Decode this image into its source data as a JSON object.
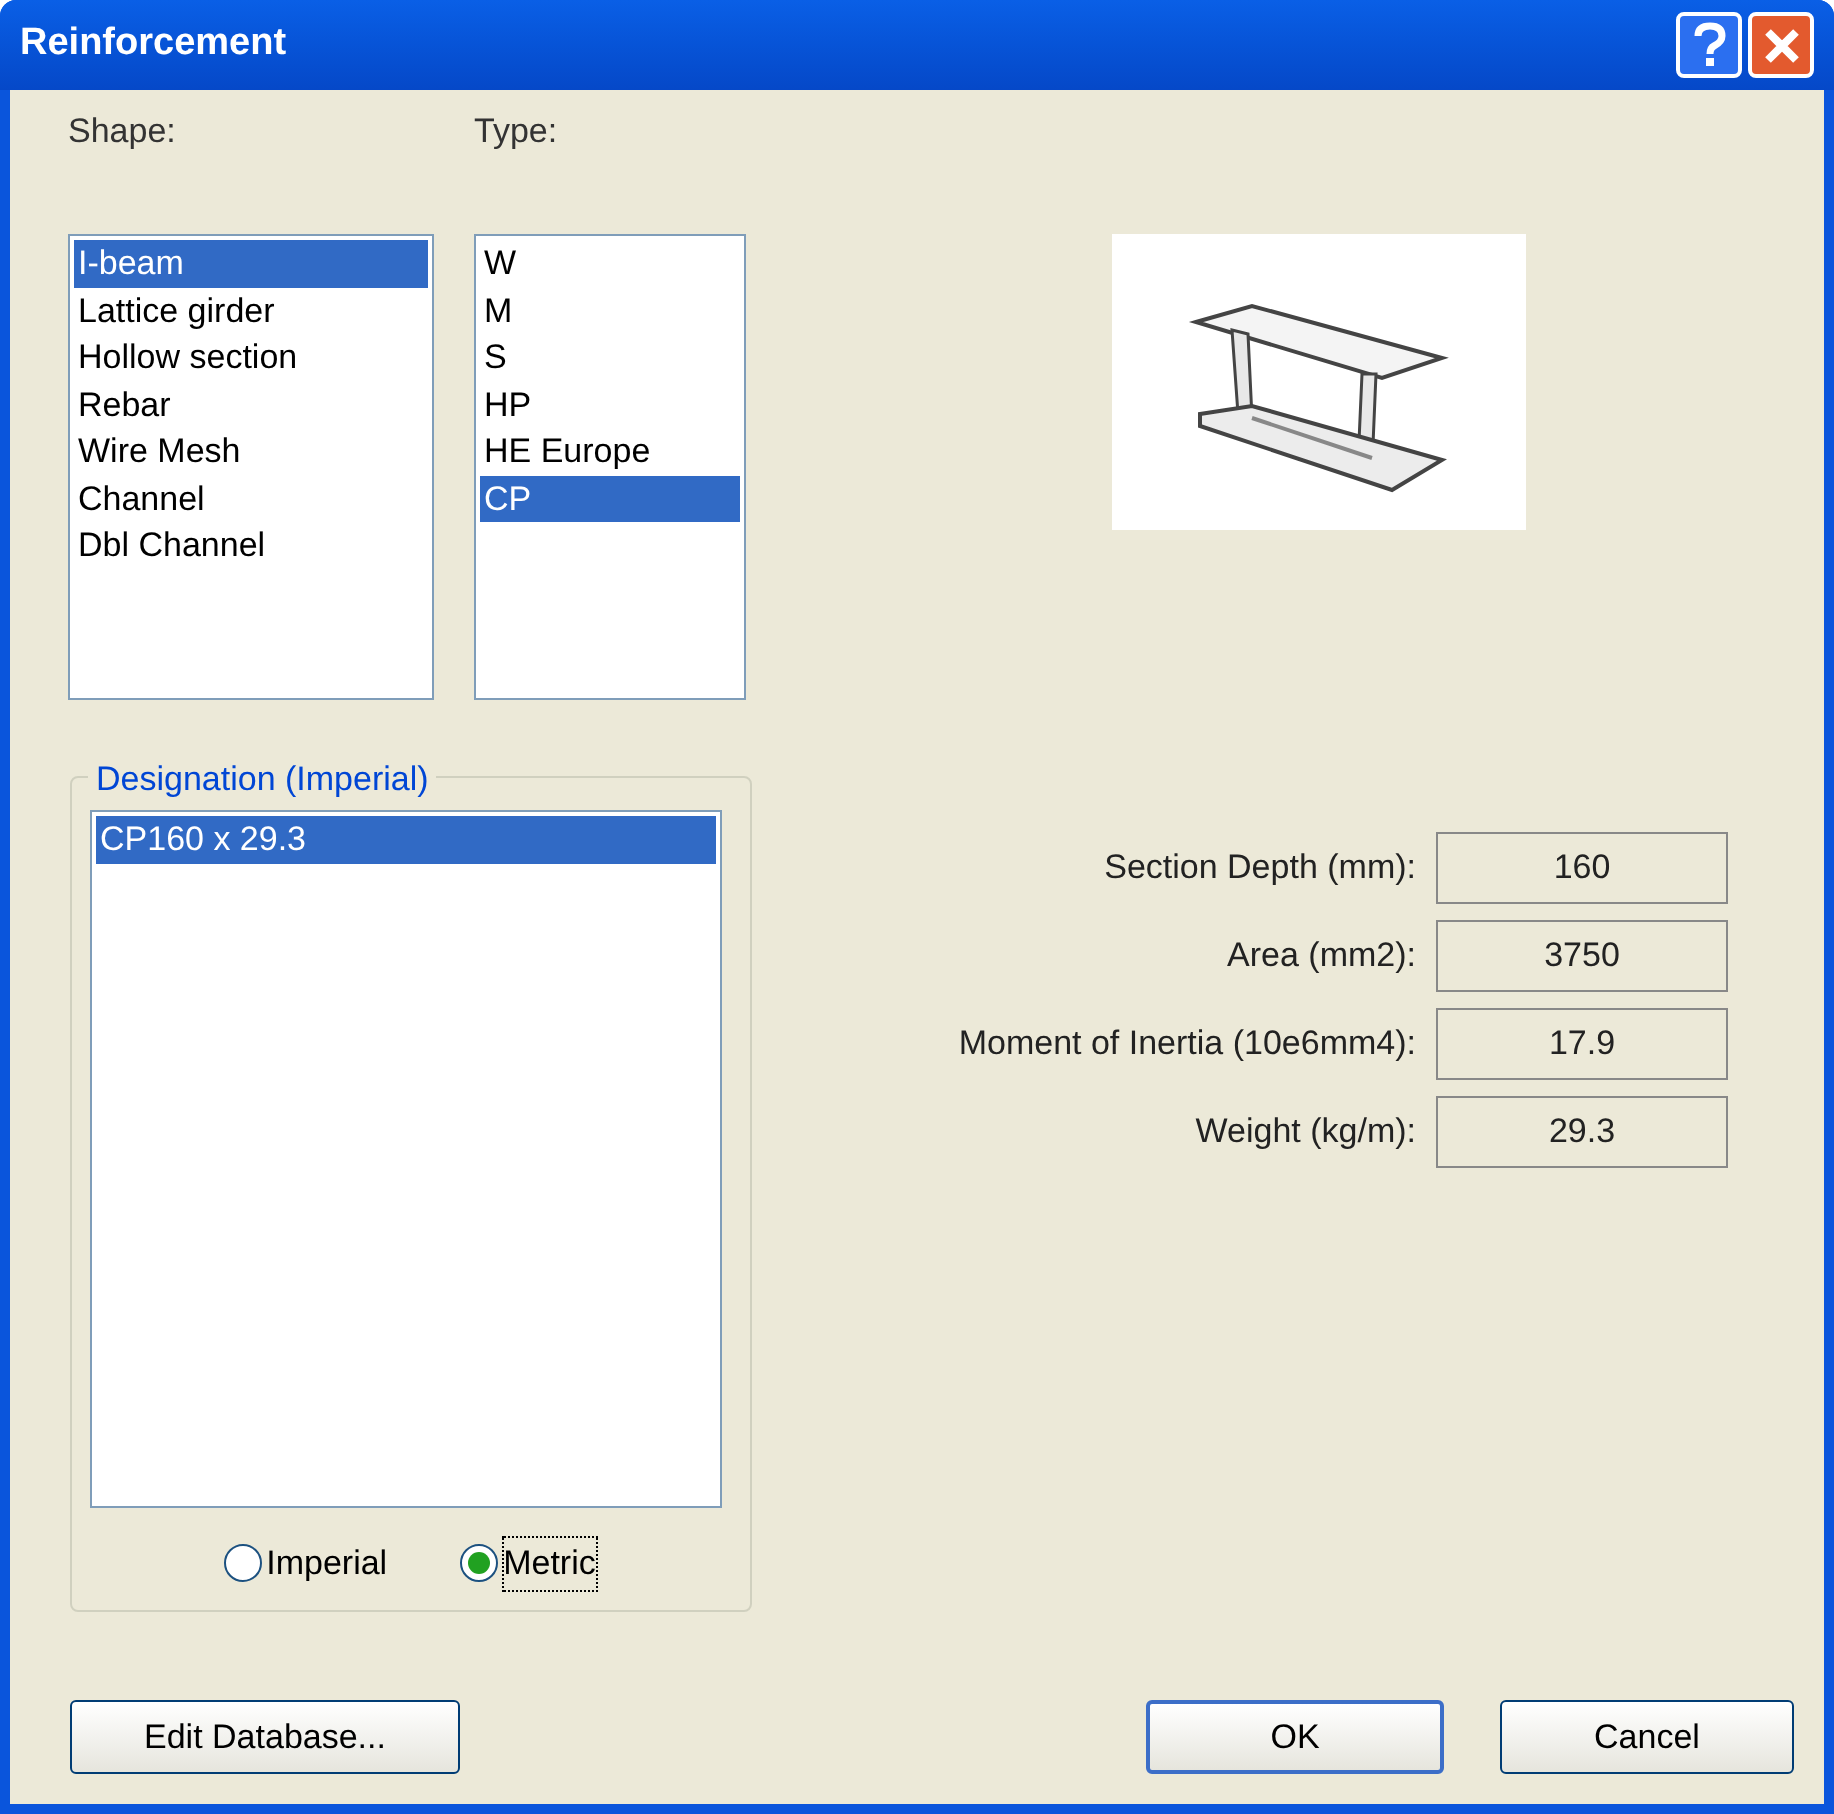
{
  "window": {
    "title": "Reinforcement"
  },
  "shape": {
    "label": "Shape:",
    "items": [
      {
        "label": "I-beam",
        "selected": true
      },
      {
        "label": "Lattice girder",
        "selected": false
      },
      {
        "label": "Hollow section",
        "selected": false
      },
      {
        "label": "Rebar",
        "selected": false
      },
      {
        "label": "Wire Mesh",
        "selected": false
      },
      {
        "label": "Channel",
        "selected": false
      },
      {
        "label": "Dbl Channel",
        "selected": false
      }
    ]
  },
  "type": {
    "label": "Type:",
    "items": [
      {
        "label": "W",
        "selected": false
      },
      {
        "label": "M",
        "selected": false
      },
      {
        "label": "S",
        "selected": false
      },
      {
        "label": "HP",
        "selected": false
      },
      {
        "label": "HE Europe",
        "selected": false
      },
      {
        "label": "CP",
        "selected": true
      }
    ]
  },
  "designation": {
    "legend": "Designation (Imperial)",
    "items": [
      {
        "label": "CP160 x 29.3",
        "selected": true
      }
    ],
    "units": [
      {
        "label": "Imperial",
        "selected": false
      },
      {
        "label": "Metric",
        "selected": true
      }
    ]
  },
  "properties": [
    {
      "label": "Section Depth (mm):",
      "value": "160"
    },
    {
      "label": "Area (mm2):",
      "value": "3750"
    },
    {
      "label": "Moment of Inertia (10e6mm4):",
      "value": "17.9"
    },
    {
      "label": "Weight (kg/m):",
      "value": "29.3"
    }
  ],
  "buttons": {
    "edit": "Edit Database...",
    "ok": "OK",
    "cancel": "Cancel"
  }
}
